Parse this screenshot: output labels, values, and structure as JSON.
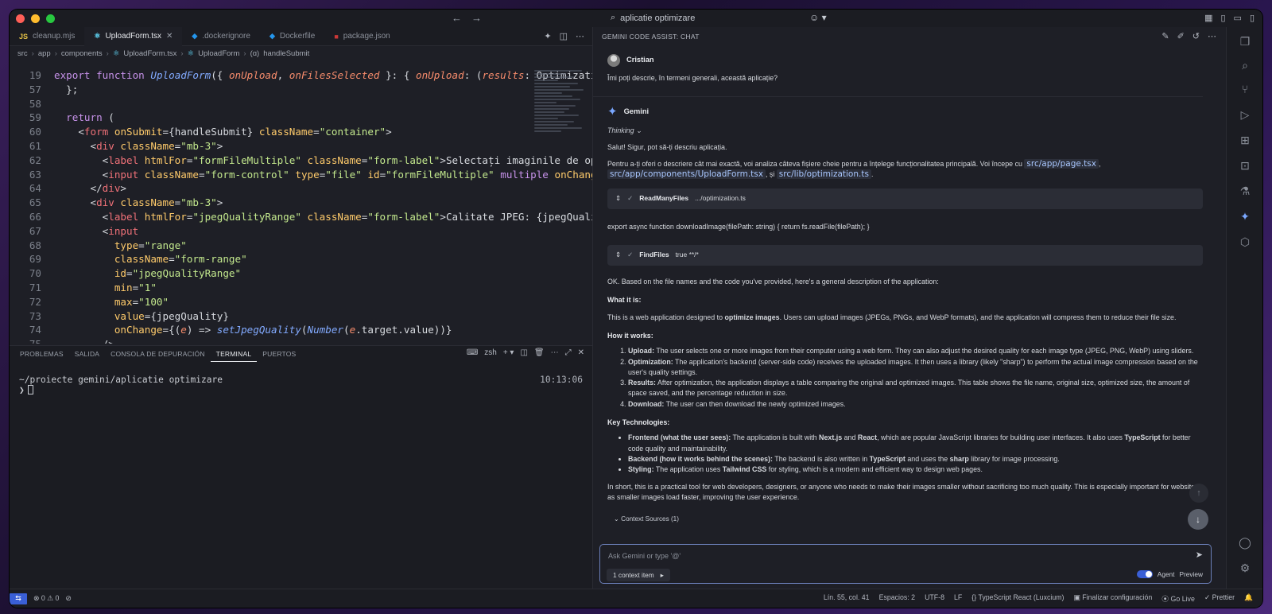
{
  "titlebar": {
    "search_text": "aplicatie optimizare"
  },
  "editor": {
    "tabs": [
      {
        "icon": "JS",
        "label": "cleanup.mjs"
      },
      {
        "icon": "react",
        "label": "UploadForm.tsx"
      },
      {
        "icon": "docker",
        "label": ".dockerignore"
      },
      {
        "icon": "docker",
        "label": "Dockerfile"
      },
      {
        "icon": "npm",
        "label": "package.json"
      }
    ],
    "breadcrumb": [
      "src",
      "app",
      "components",
      "UploadForm.tsx",
      "UploadForm",
      "handleSubmit"
    ],
    "lines": [
      {
        "n": "19",
        "code": "export function UploadForm({ onUpload, onFilesSelected }: { onUpload: (results: OptimizationRe"
      },
      {
        "n": "57",
        "code": "  };"
      },
      {
        "n": "58",
        "code": ""
      },
      {
        "n": "59",
        "code": "  return ("
      },
      {
        "n": "60",
        "code": "    <form onSubmit={handleSubmit} className=\"container\">"
      },
      {
        "n": "61",
        "code": "      <div className=\"mb-3\">"
      },
      {
        "n": "62",
        "code": "        <label htmlFor=\"formFileMultiple\" className=\"form-label\">Selectați imaginile de optim"
      },
      {
        "n": "63",
        "code": "        <input className=\"form-control\" type=\"file\" id=\"formFileMultiple\" multiple onChange={("
      },
      {
        "n": "64",
        "code": "      </div>"
      },
      {
        "n": "65",
        "code": "      <div className=\"mb-3\">"
      },
      {
        "n": "66",
        "code": "        <label htmlFor=\"jpegQualityRange\" className=\"form-label\">Calitate JPEG: {jpegQuality}%"
      },
      {
        "n": "67",
        "code": "        <input"
      },
      {
        "n": "68",
        "code": "          type=\"range\""
      },
      {
        "n": "69",
        "code": "          className=\"form-range\""
      },
      {
        "n": "70",
        "code": "          id=\"jpegQualityRange\""
      },
      {
        "n": "71",
        "code": "          min=\"1\""
      },
      {
        "n": "72",
        "code": "          max=\"100\""
      },
      {
        "n": "73",
        "code": "          value={jpegQuality}"
      },
      {
        "n": "74",
        "code": "          onChange={(e) => setJpegQuality(Number(e.target.value))}"
      },
      {
        "n": "75",
        "code": "        />"
      }
    ]
  },
  "panel": {
    "tabs": [
      "PROBLEMAS",
      "SALIDA",
      "CONSOLA DE DEPURACIÓN",
      "TERMINAL",
      "PUERTOS"
    ],
    "active_tab": "TERMINAL",
    "shell": "zsh",
    "terminal_path": "~/proiecte gemini/aplicatie optimizare",
    "terminal_prompt": "❯",
    "terminal_time": "10:13:06"
  },
  "chat": {
    "header": "GEMINI CODE ASSIST: CHAT",
    "user_name": "Cristian",
    "user_message": "Îmi poți descrie, în termeni generali, această aplicație?",
    "bot_name": "Gemini",
    "thinking": "Thinking",
    "greeting": "Salut! Sigur, pot să-ți descriu aplicația.",
    "intro_text": "Pentru a-ți oferi o descriere cât mai exactă, voi analiza câteva fișiere cheie pentru a înțelege funcționalitatea principală. Voi începe cu",
    "file1": "src/app/page.tsx",
    "file2": "src/app/components/UploadForm.tsx",
    "file3": "src/lib/optimization.ts",
    "and_word": ", și",
    "tool1_name": "ReadManyFiles",
    "tool1_arg": ".../optimization.ts",
    "code_snippet": "export async function downloadImage(filePath: string) { return fs.readFile(filePath); }",
    "tool2_name": "FindFiles",
    "tool2_arg": "true **/*",
    "ok_text": "OK. Based on the file names and the code you've provided, here's a general description of the application:",
    "what_heading": "What it is:",
    "what_text_a": "This is a web application designed to",
    "what_bold": "optimize images",
    "what_text_b": ". Users can upload images (JPEGs, PNGs, and WebP formats), and the application will compress them to reduce their file size.",
    "how_heading": "How it works:",
    "how_items": [
      {
        "b": "Upload:",
        "t": " The user selects one or more images from their computer using a web form. They can also adjust the desired quality for each image type (JPEG, PNG, WebP) using sliders."
      },
      {
        "b": "Optimization:",
        "t": " The application's backend (server-side code) receives the uploaded images. It then uses a library (likely \"sharp\") to perform the actual image compression based on the user's quality settings."
      },
      {
        "b": "Results:",
        "t": " After optimization, the application displays a table comparing the original and optimized images. This table shows the file name, original size, optimized size, the amount of space saved, and the percentage reduction in size."
      },
      {
        "b": "Download:",
        "t": " The user can then download the newly optimized images."
      }
    ],
    "tech_heading": "Key Technologies:",
    "tech_frontend_b": "Frontend (what the user sees):",
    "tech_frontend_t1": " The application is built with",
    "tech_next": "Next.js",
    "tech_and": " and",
    "tech_react": "React",
    "tech_frontend_t2": ", which are popular JavaScript libraries for building user interfaces. It also uses",
    "tech_ts": "TypeScript",
    "tech_frontend_t3": " for better code quality and maintainability.",
    "tech_backend_b": "Backend (how it works behind the scenes):",
    "tech_backend_t1": " The backend is also written in",
    "tech_backend_ts": "TypeScript",
    "tech_backend_t2": " and uses the",
    "tech_sharp": "sharp",
    "tech_backend_t3": " library for image processing.",
    "tech_styling_b": "Styling:",
    "tech_styling_t1": " The application uses",
    "tech_tailwind": "Tailwind CSS",
    "tech_styling_t2": " for styling, which is a modern and efficient way to design web pages.",
    "summary": "In short, this is a practical tool for web developers, designers, or anyone who needs to make their images smaller without sacrificing too much quality. This is especially important for websites, as smaller images load faster, improving the user experience.",
    "context_sources": "Context Sources (1)",
    "input_placeholder": "Ask Gemini or type '@'",
    "context_item": "1 context item",
    "agent_label": "Agent",
    "preview_label": "Preview"
  },
  "status": {
    "errors": "0",
    "warnings": "0",
    "position": "Lín. 55, col. 41",
    "spaces": "Espacios: 2",
    "encoding": "UTF-8",
    "eol": "LF",
    "language": "TypeScript React (Luxcium)",
    "finalize": "Finalizar configuración",
    "golive": "Go Live",
    "prettier": "Prettier"
  }
}
